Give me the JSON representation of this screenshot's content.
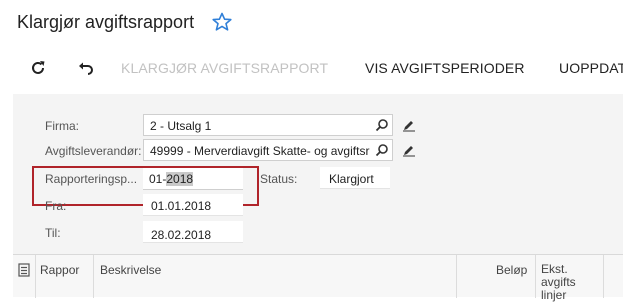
{
  "page": {
    "title": "Klargjør avgiftsrapport"
  },
  "toolbar": {
    "refresh_icon": "refresh-icon",
    "undo_icon": "undo-icon",
    "buttons": [
      {
        "label": "KLARGJØR AVGIFTSRAPPORT",
        "enabled": false
      },
      {
        "label": "VIS AVGIFTSPERIODER",
        "enabled": true
      },
      {
        "label": "UOPPDAT",
        "enabled": true
      }
    ]
  },
  "form": {
    "firma": {
      "label": "Firma:",
      "value": "2 - Utsalg 1"
    },
    "leverandor": {
      "label": "Avgiftsleverandør:",
      "value": "49999 - Merverdiavgift Skatte- og avgiftsr"
    },
    "rapport": {
      "label": "Rapporteringsp...",
      "value_prefix": "01-",
      "value_selected": "2018"
    },
    "status": {
      "label": "Status:",
      "value": "Klargjort"
    },
    "fra": {
      "label": "Fra:",
      "value": "01.01.2018"
    },
    "til": {
      "label": "Til:",
      "value": "28.02.2018"
    }
  },
  "grid": {
    "columns": [
      "Rappor",
      "Beskrivelse",
      "Beløp",
      "Ekst. avgifts linjer"
    ]
  },
  "colors": {
    "highlight": "#b0242a",
    "star": "#2f7fd8"
  }
}
